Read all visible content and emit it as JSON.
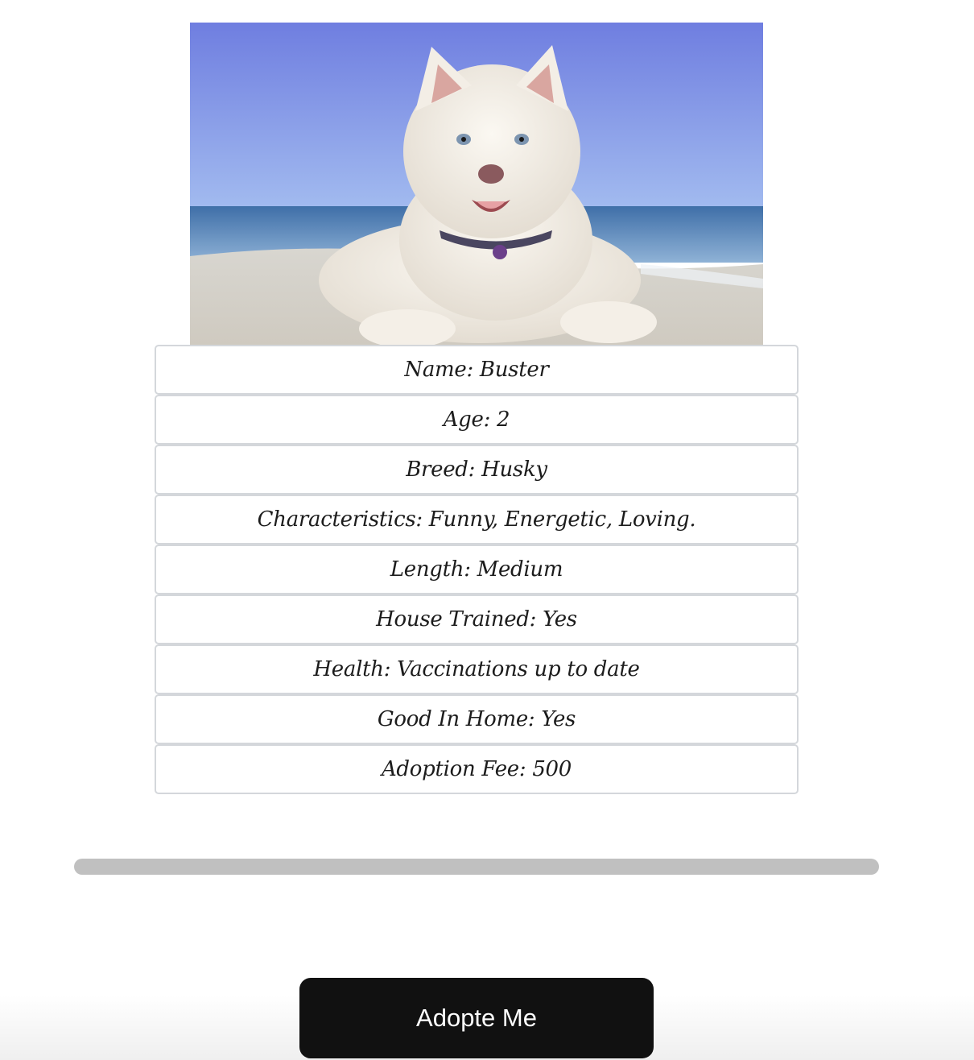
{
  "pet": {
    "photo_alt": "Buster",
    "details": [
      {
        "label": "Name: Buster"
      },
      {
        "label": "Age: 2"
      },
      {
        "label": "Breed: Husky"
      },
      {
        "label": "Characteristics: Funny, Energetic, Loving."
      },
      {
        "label": "Length: Medium"
      },
      {
        "label": "House Trained: Yes"
      },
      {
        "label": "Health: Vaccinations up to date"
      },
      {
        "label": "Good In Home: Yes"
      },
      {
        "label": "Adoption Fee: 500"
      }
    ]
  },
  "actions": {
    "adopt_label": "Adopte Me"
  },
  "colors": {
    "button_bg": "#111111",
    "scroll_track": "#c0c0c0",
    "row_border": "#d4d7db"
  }
}
